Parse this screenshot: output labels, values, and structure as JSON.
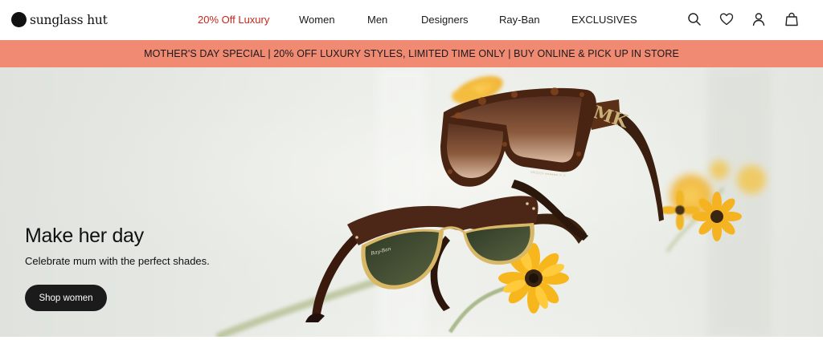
{
  "brand": {
    "name": "sunglass hut"
  },
  "nav": {
    "items": [
      {
        "label": "20% Off Luxury",
        "accent": true
      },
      {
        "label": "Women"
      },
      {
        "label": "Men"
      },
      {
        "label": "Designers"
      },
      {
        "label": "Ray-Ban"
      },
      {
        "label": "EXCLUSIVES"
      }
    ]
  },
  "header_icons": [
    "search-icon",
    "heart-icon",
    "user-icon",
    "bag-icon"
  ],
  "promo": {
    "text": "MOTHER'S DAY SPECIAL | 20% OFF LUXURY STYLES, LIMITED TIME ONLY | BUY ONLINE & PICK UP IN STORE"
  },
  "hero": {
    "title": "Make her day",
    "subtitle": "Celebrate mum with the perfect shades.",
    "cta_label": "Shop women",
    "logo_text": "MK",
    "temple_text": "Ray-Ban"
  },
  "colors": {
    "accent": "#c8261c",
    "promo_bg": "#f08a73",
    "button_bg": "#1b1b1b"
  }
}
